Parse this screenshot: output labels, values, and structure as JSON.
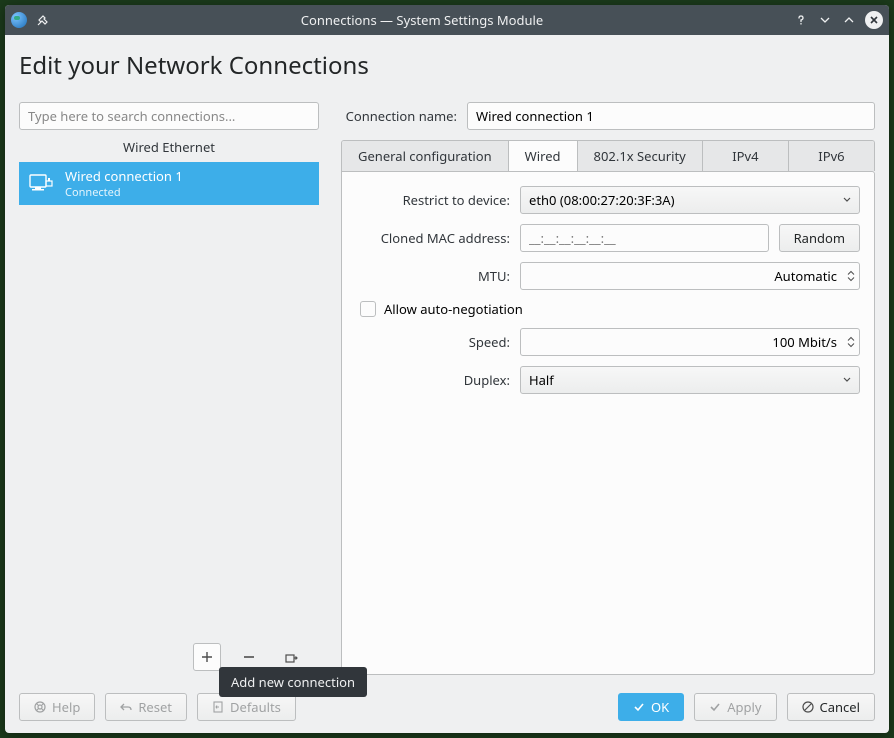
{
  "window": {
    "title": "Connections — System Settings Module"
  },
  "page": {
    "heading": "Edit your Network Connections"
  },
  "search": {
    "placeholder": "Type here to search connections..."
  },
  "sidebar": {
    "group_header": "Wired Ethernet",
    "items": [
      {
        "name": "Wired connection 1",
        "status": "Connected"
      }
    ],
    "tooltip_add": "Add new connection"
  },
  "connection": {
    "name_label": "Connection name:",
    "name_value": "Wired connection 1"
  },
  "tabs": {
    "general": "General configuration",
    "wired": "Wired",
    "security": "802.1x Security",
    "ipv4": "IPv4",
    "ipv6": "IPv6"
  },
  "wired": {
    "restrict_label": "Restrict to device:",
    "restrict_value": "eth0 (08:00:27:20:3F:3A)",
    "mac_label": "Cloned MAC address:",
    "mac_placeholder": "__:__:__:__:__:__",
    "random_btn": "Random",
    "mtu_label": "MTU:",
    "mtu_value": "Automatic",
    "auto_neg_label": "Allow auto-negotiation",
    "speed_label": "Speed:",
    "speed_value": "100 Mbit/s",
    "duplex_label": "Duplex:",
    "duplex_value": "Half"
  },
  "footer": {
    "help": "Help",
    "reset": "Reset",
    "defaults": "Defaults",
    "ok": "OK",
    "apply": "Apply",
    "cancel": "Cancel"
  }
}
